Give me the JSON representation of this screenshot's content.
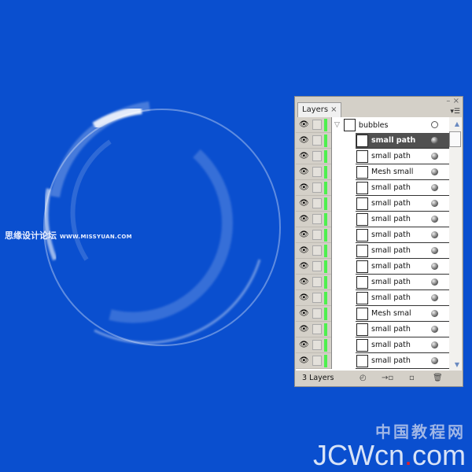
{
  "canvas": {
    "background": "#0a4fcf"
  },
  "watermark_top": {
    "cn": "思缘设计论坛",
    "url": "WWW.MISSYUAN.COM"
  },
  "watermark_bottom": {
    "cn": "中国教程网",
    "en_left": "JCWcn",
    "en_dot": ".",
    "en_right": "com"
  },
  "layers_panel": {
    "tab_label": "Layers",
    "tab_close": "×",
    "minimize": "–",
    "close": "×",
    "menu_icon": "panel-menu-icon",
    "top_layer": {
      "name": "bubbles",
      "visible": true
    },
    "sublayers": [
      {
        "name": "small path",
        "selected": true
      },
      {
        "name": "small path"
      },
      {
        "name": "Mesh small"
      },
      {
        "name": "small path"
      },
      {
        "name": "small path"
      },
      {
        "name": "small path"
      },
      {
        "name": "small path"
      },
      {
        "name": "small path"
      },
      {
        "name": "small path"
      },
      {
        "name": "small path"
      },
      {
        "name": "small path"
      },
      {
        "name": "Mesh smal"
      },
      {
        "name": "small path"
      },
      {
        "name": "small path"
      },
      {
        "name": "small path"
      }
    ],
    "layer_count": "3 Layers",
    "layer_color": "#4ef04e",
    "footer_icons": [
      "make-clipping-mask-icon",
      "create-sublayer-icon",
      "new-layer-icon",
      "trash-icon"
    ]
  }
}
